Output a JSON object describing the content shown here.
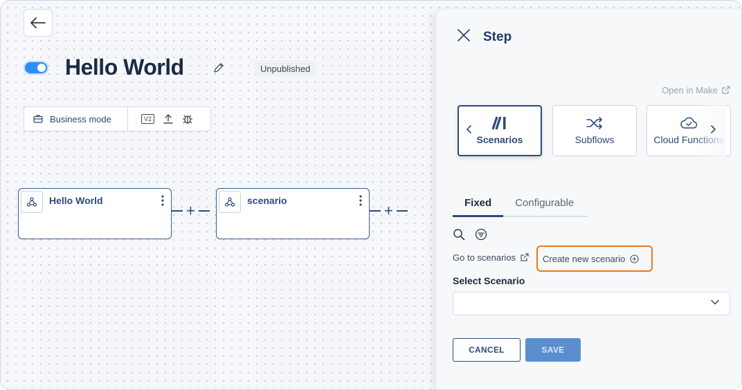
{
  "canvas": {
    "title": "Hello World",
    "status": "Unpublished",
    "mode_label": "Business mode",
    "version_badge": "V2",
    "nodes": [
      {
        "title": "Hello World"
      },
      {
        "title": "scenario"
      }
    ],
    "connector_symbol": "+"
  },
  "panel": {
    "title": "Step",
    "open_in_make": "Open in Make",
    "cards": [
      {
        "label": "Scenarios",
        "icon": "make-logo-icon",
        "active": true
      },
      {
        "label": "Subflows",
        "icon": "shuffle-icon",
        "active": false
      },
      {
        "label": "Cloud Functions",
        "icon": "cloud-icon",
        "active": false
      }
    ],
    "tabs": [
      {
        "label": "Fixed",
        "active": true
      },
      {
        "label": "Configurable",
        "active": false
      }
    ],
    "goto_link": "Go to scenarios",
    "create_button": "Create new scenario",
    "select_label": "Select Scenario",
    "select_value": "",
    "cancel_label": "CANCEL",
    "save_label": "SAVE"
  },
  "colors": {
    "accent": "#2b4a7a",
    "toggle_on": "#2d8cff",
    "highlight": "#e87a1e",
    "save_disabled": "#5b8ecf"
  }
}
